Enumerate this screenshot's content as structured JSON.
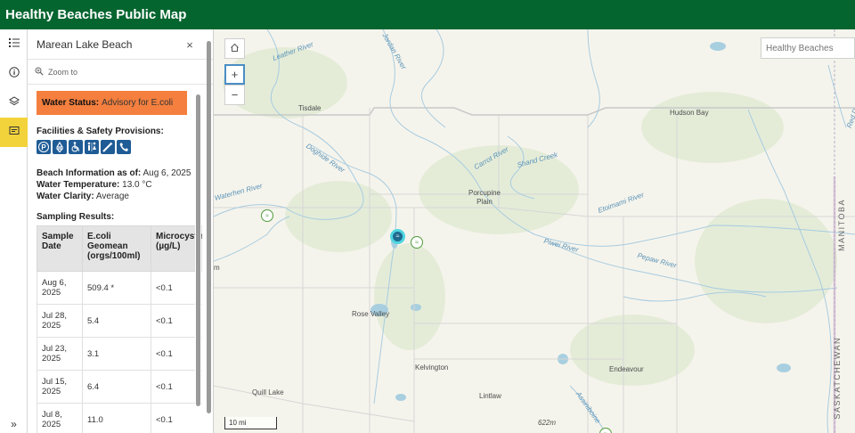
{
  "app": {
    "title": "Healthy Beaches Public Map"
  },
  "rail": {
    "items": [
      {
        "icon": "list-icon",
        "active": false
      },
      {
        "icon": "info-icon",
        "active": false
      },
      {
        "icon": "layers-icon",
        "active": false
      },
      {
        "icon": "popup-details-icon",
        "active": true
      }
    ],
    "expand_glyph": "»"
  },
  "panel": {
    "title": "Marean Lake Beach",
    "close_glyph": "×",
    "zoom_to": "Zoom to",
    "status_label": "Water Status:",
    "status_value": "Advisory for E.coli",
    "status_color": "#f47f3e",
    "facilities_label": "Facilities & Safety Provisions:",
    "facility_icons": [
      "parking-icon",
      "recycling-icon",
      "accessible-icon",
      "washroom-icon",
      "syringe-disposal-icon",
      "phone-icon"
    ],
    "info_date_label": "Beach Information as of:",
    "info_date": "Aug 6, 2025",
    "water_temp_label": "Water Temperature:",
    "water_temp": "13.0 °C",
    "water_clarity_label": "Water Clarity:",
    "water_clarity": "Average",
    "sampling_label": "Sampling Results:",
    "table": {
      "headers": [
        "Sample Date",
        "E.coli Geomean (orgs/100ml)",
        "Microcystin (µg/L)"
      ],
      "header_display_3": "Microcys",
      "rows": [
        [
          "Aug 6, 2025",
          "509.4 *",
          "<0.1"
        ],
        [
          "Jul 28, 2025",
          "5.4",
          "<0.1"
        ],
        [
          "Jul 23, 2025",
          "3.1",
          "<0.1"
        ],
        [
          "Jul 15, 2025",
          "6.4",
          "<0.1"
        ],
        [
          "Jul 8, 2025",
          "11.0",
          "<0.1"
        ]
      ]
    }
  },
  "map": {
    "search_placeholder": "Healthy Beaches",
    "zoom_in": "+",
    "zoom_out": "−",
    "scale": "10 mi",
    "places": [
      "Tisdale",
      "Hudson Bay",
      "Porcupine Plain",
      "Rose Valley",
      "Kelvington",
      "Endeavour",
      "Quill Lake",
      "Lintlaw"
    ],
    "rivers": [
      "Leather River",
      "Jordan River",
      "Doghide River",
      "Carrot River",
      "Shand Creek",
      "Etoimami River",
      "Piwei River",
      "Pepaw River",
      "Waterhen River",
      "Red Deer River",
      "Assiniboine"
    ],
    "province_labels": [
      "MANITOBA",
      "SASKATCHEWAN"
    ],
    "elevation": "622m",
    "partial_label": "m"
  }
}
